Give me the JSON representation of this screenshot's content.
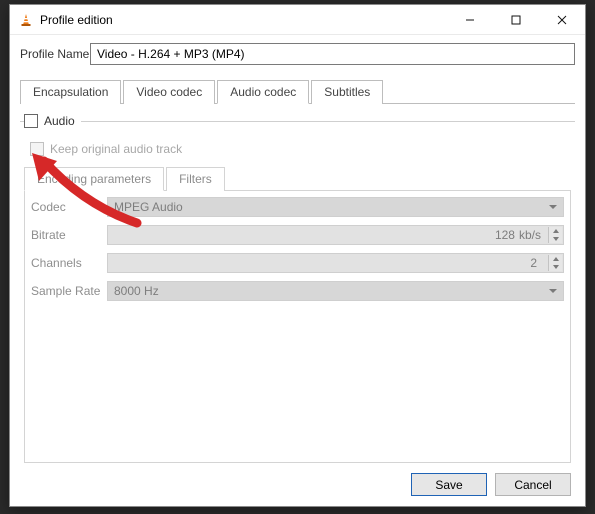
{
  "window": {
    "title": "Profile edition"
  },
  "profile": {
    "label": "Profile Name",
    "value": "Video - H.264 + MP3 (MP4)"
  },
  "outer_tabs": {
    "encapsulation": "Encapsulation",
    "video_codec": "Video codec",
    "audio_codec": "Audio codec",
    "subtitles": "Subtitles"
  },
  "audio": {
    "legend": "Audio",
    "keep_original": "Keep original audio track"
  },
  "inner_tabs": {
    "encoding_parameters": "Encoding parameters",
    "filters": "Filters"
  },
  "params": {
    "codec": {
      "label": "Codec",
      "value": "MPEG Audio"
    },
    "bitrate": {
      "label": "Bitrate",
      "value": "128",
      "unit": "kb/s"
    },
    "channels": {
      "label": "Channels",
      "value": "2"
    },
    "sample_rate": {
      "label": "Sample Rate",
      "value": "8000 Hz"
    }
  },
  "footer": {
    "save": "Save",
    "cancel": "Cancel"
  }
}
